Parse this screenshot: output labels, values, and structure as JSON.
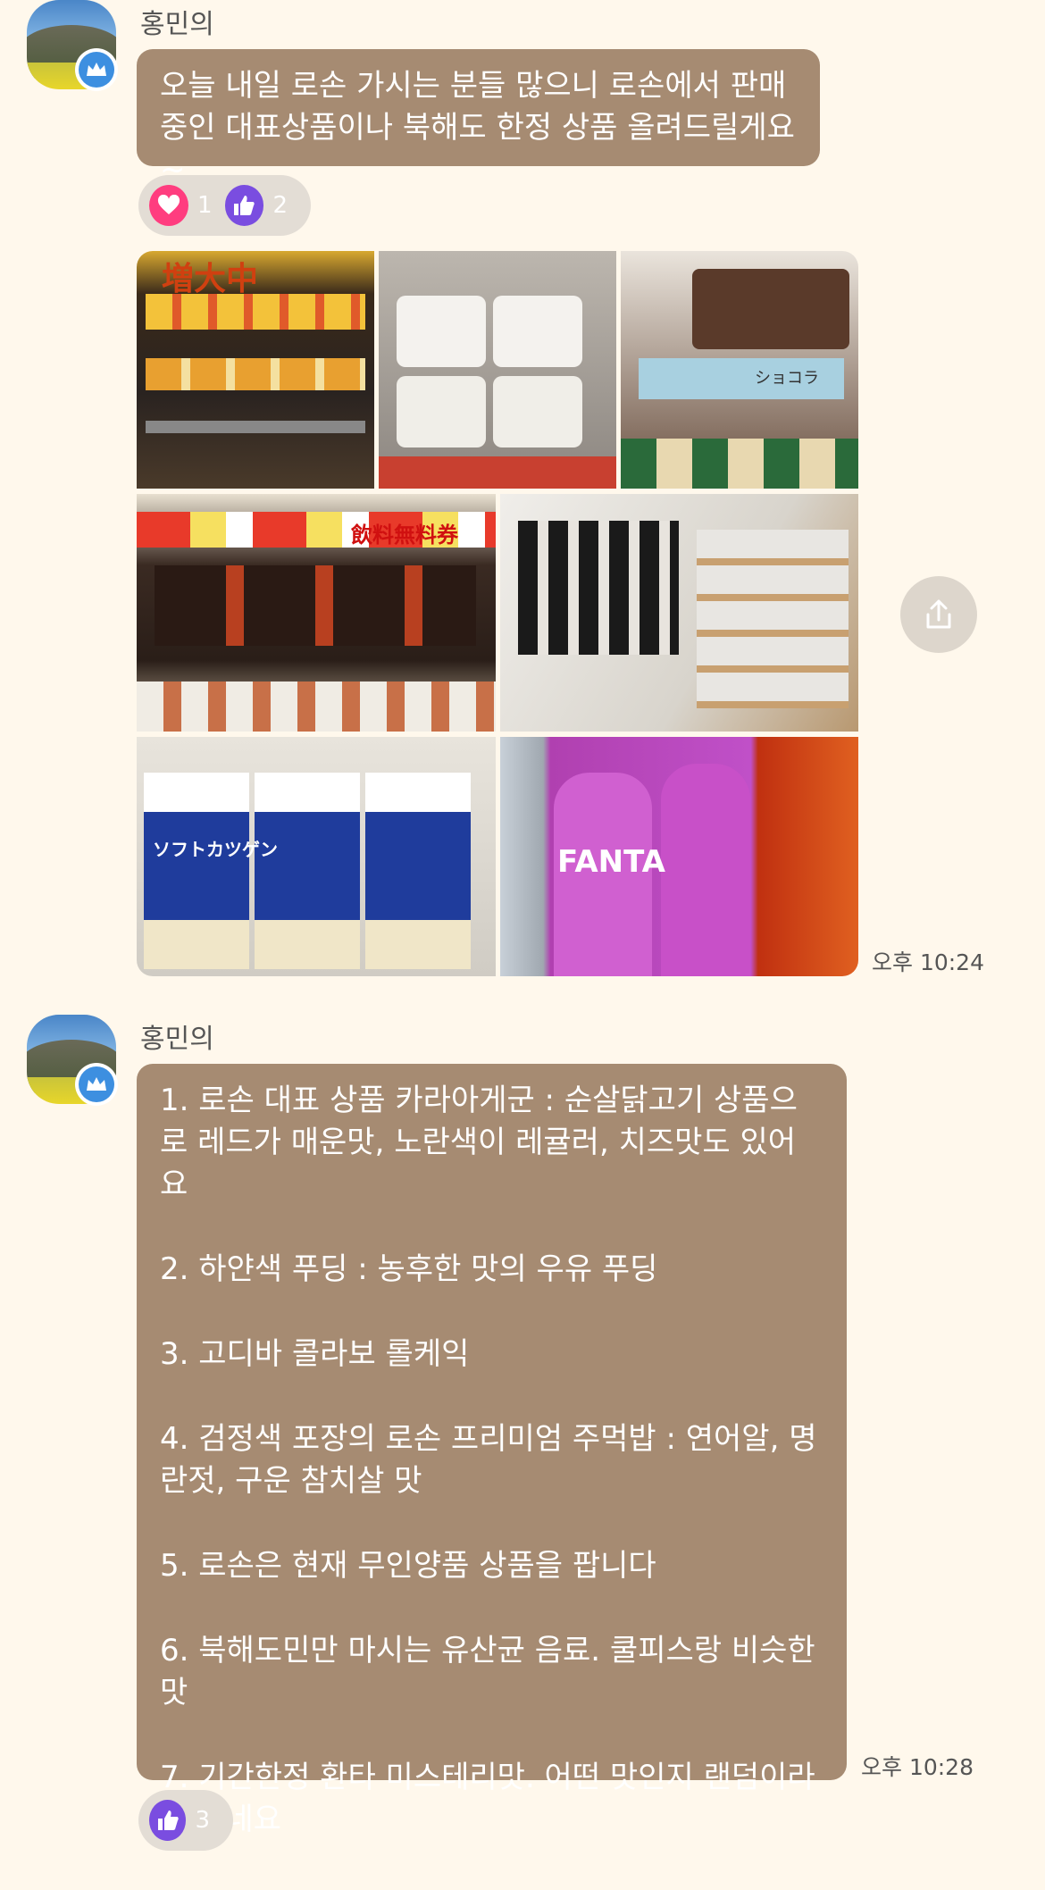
{
  "messages": [
    {
      "sender": "홍민의",
      "text": "오늘 내일 로손 가시는 분들 많으니 로손에서 판매중인 대표상품이나 북해도 한정 상품 올려드릴게요~",
      "reactions": [
        {
          "icon": "heart-icon",
          "count": "1",
          "color": "#ff3d7f"
        },
        {
          "icon": "thumbs-up-icon",
          "count": "2",
          "color": "#7a4de0"
        }
      ]
    },
    {
      "photos": [
        {
          "name": "photo-karaage-kun-shelf",
          "overlay": "増大中"
        },
        {
          "name": "photo-white-pudding"
        },
        {
          "name": "photo-godiva-roll-cake",
          "overlay": "ショコラ"
        },
        {
          "name": "photo-onigiri-shelf",
          "overlay": "飲料無料券"
        },
        {
          "name": "photo-muji-socks"
        },
        {
          "name": "photo-soft-curdgen",
          "overlay": "ソフトカツゲン"
        },
        {
          "name": "photo-fanta-mystery",
          "overlay": "FANTA"
        }
      ],
      "time": "오후 10:24"
    },
    {
      "sender": "홍민의",
      "lines": [
        "1. 로손 대표 상품 카라아게군 : 순살닭고기 상품으로 레드가 매운맛, 노란색이 레귤러, 치즈맛도 있어요",
        "2. 하얀색 푸딩 : 농후한 맛의 우유 푸딩",
        "3. 고디바 콜라보 롤케익",
        "4. 검정색 포장의 로손 프리미엄 주먹밥 : 연어알, 명란젓, 구운 참치살 맛",
        "5. 로손은 현재 무인양품 상품을 팝니다",
        "6. 북해도민만 마시는 유산균 음료. 쿨피스랑 비슷한 맛",
        "7. 기간한정 환타 미스테리맛. 어떤 맛인지 랜덤이라고 하네요"
      ],
      "time": "오후 10:28",
      "reactions": [
        {
          "icon": "thumbs-up-icon",
          "count": "3",
          "color": "#7a4de0"
        }
      ]
    }
  ],
  "colors": {
    "background": "#fff8ec",
    "bubble": "#a68b72",
    "reaction_pill": "#e3ddd5"
  }
}
